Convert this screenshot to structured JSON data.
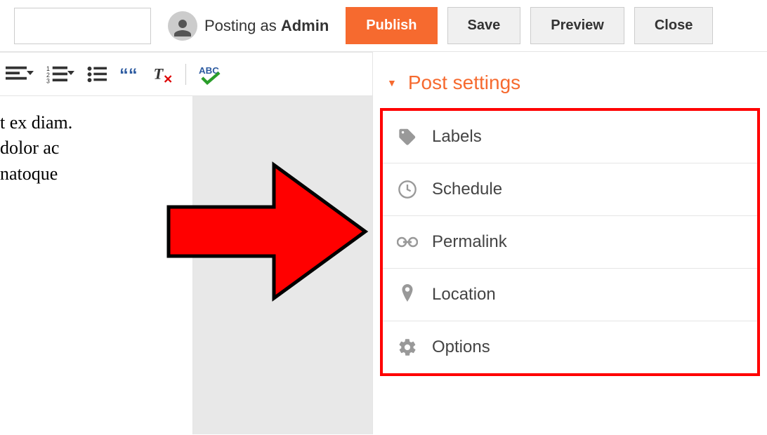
{
  "header": {
    "title_value": "",
    "posting_as_prefix": "Posting as ",
    "posting_as_user": "Admin",
    "buttons": {
      "publish": "Publish",
      "save": "Save",
      "preview": "Preview",
      "close": "Close"
    }
  },
  "editor": {
    "content_line1": "t ex diam.",
    "content_line2": "dolor ac",
    "content_line3": " natoque"
  },
  "sidebar": {
    "title": "Post settings",
    "items": [
      {
        "label": "Labels"
      },
      {
        "label": "Schedule"
      },
      {
        "label": "Permalink"
      },
      {
        "label": "Location"
      },
      {
        "label": "Options"
      }
    ]
  }
}
